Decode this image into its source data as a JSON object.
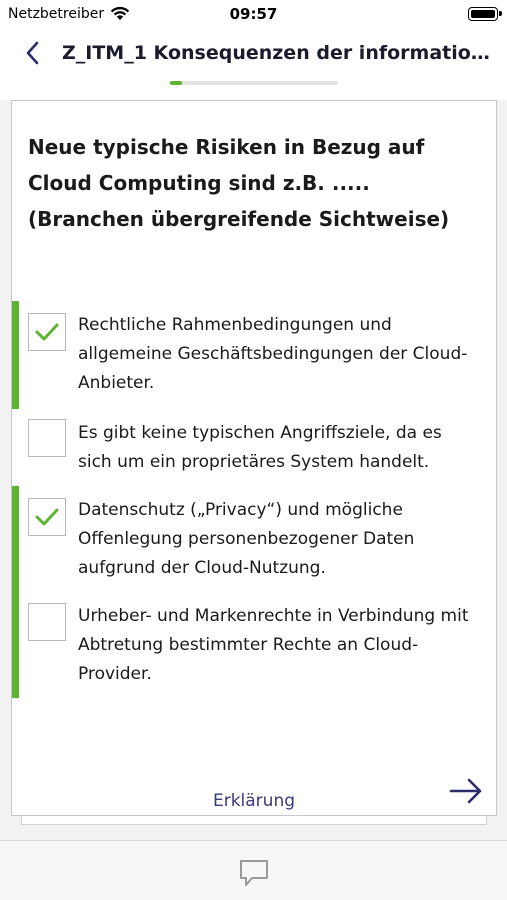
{
  "status_bar": {
    "carrier": "Netzbetreiber",
    "time": "09:57"
  },
  "header": {
    "title": "Z_ITM_1 Konsequenzen der informationell...",
    "progress": 0.07
  },
  "question": {
    "text": "Neue typische Risiken in Bezug auf Cloud Computing sind z.B. ..... (Branchen übergreifende Sichtweise)"
  },
  "answers": [
    {
      "label": "Rechtliche Rahmenbedingungen und allgemeine Geschäftsbedingungen der Cloud-Anbieter.",
      "checked": true,
      "correct": true
    },
    {
      "label": "Es gibt keine typischen Angriffsziele, da es sich um ein proprietäres System handelt.",
      "checked": false,
      "correct": false
    },
    {
      "label": "Datenschutz („Privacy“) und mögliche Offenlegung personenbezogener Daten aufgrund der Cloud-Nutzung.",
      "checked": true,
      "correct": true
    },
    {
      "label": "Urheber- und Markenrechte in Verbindung mit Abtretung bestimmter Rechte an Cloud-Provider.",
      "checked": false,
      "correct": true
    }
  ],
  "footer": {
    "explain_label": "Erklärung",
    "next_icon": "arrow-right-icon",
    "chat_icon": "chat-bubble-icon"
  },
  "colors": {
    "accent": "#5cb531",
    "link": "#3a3a7a",
    "arrow": "#2b2b6b"
  }
}
